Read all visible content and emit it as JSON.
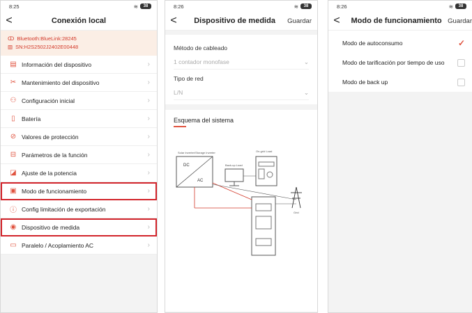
{
  "screen1": {
    "status": {
      "time": "8:25",
      "battery": "38"
    },
    "title": "Conexión local",
    "bluetooth": "Bluetooth:BlueLink:28245",
    "sn": "SN:H2S2502J2402E00448",
    "menu": [
      {
        "label": "Información del dispositivo",
        "icon": "list-icon",
        "glyph": "▤"
      },
      {
        "label": "Mantenimiento del dispositivo",
        "icon": "tools-icon",
        "glyph": "✂"
      },
      {
        "label": "Configuración inicial",
        "icon": "user-settings-icon",
        "glyph": "⚇"
      },
      {
        "label": "Batería",
        "icon": "battery-icon",
        "glyph": "▯"
      },
      {
        "label": "Valores de protección",
        "icon": "protection-icon",
        "glyph": "⊘"
      },
      {
        "label": "Parámetros de la función",
        "icon": "parameters-icon",
        "glyph": "⊟"
      },
      {
        "label": "Ajuste de la potencia",
        "icon": "power-adjust-icon",
        "glyph": "◪"
      },
      {
        "label": "Modo de funcionamiento",
        "icon": "mode-icon",
        "glyph": "▣"
      },
      {
        "label": "Config limitación de exportación",
        "icon": "export-limit-icon",
        "glyph": "ⓘ"
      },
      {
        "label": "Dispositivo de medida",
        "icon": "meter-icon",
        "glyph": "◉"
      },
      {
        "label": "Paralelo / Acoplamiento AC",
        "icon": "parallel-icon",
        "glyph": "▭"
      }
    ]
  },
  "screen2": {
    "status": {
      "time": "8:26",
      "battery": "38"
    },
    "title": "Dispositivo de medida",
    "save": "Guardar",
    "wiring_label": "Método de cableado",
    "wiring_value": "1 contador monofase",
    "grid_label": "Tipo de red",
    "grid_value": "L/N",
    "schema_title": "Esquema del sistema",
    "diagram": {
      "inverter_label": "Solar Inverter/Storage Inverter",
      "dc": "DC",
      "ac": "AC",
      "backup": "Back-up Load",
      "onload": "On-grid Load",
      "grid": "Grid"
    }
  },
  "screen3": {
    "status": {
      "time": "8:26",
      "battery": "38"
    },
    "title": "Modo de funcionamiento",
    "save": "Guardar",
    "modes": [
      {
        "label": "Modo de autoconsumo",
        "selected": true
      },
      {
        "label": "Modo de tarificación por tiempo de uso",
        "selected": false
      },
      {
        "label": "Modo de back up",
        "selected": false
      }
    ]
  },
  "colors": {
    "accent": "#e0533f",
    "highlight": "#d2232a"
  }
}
